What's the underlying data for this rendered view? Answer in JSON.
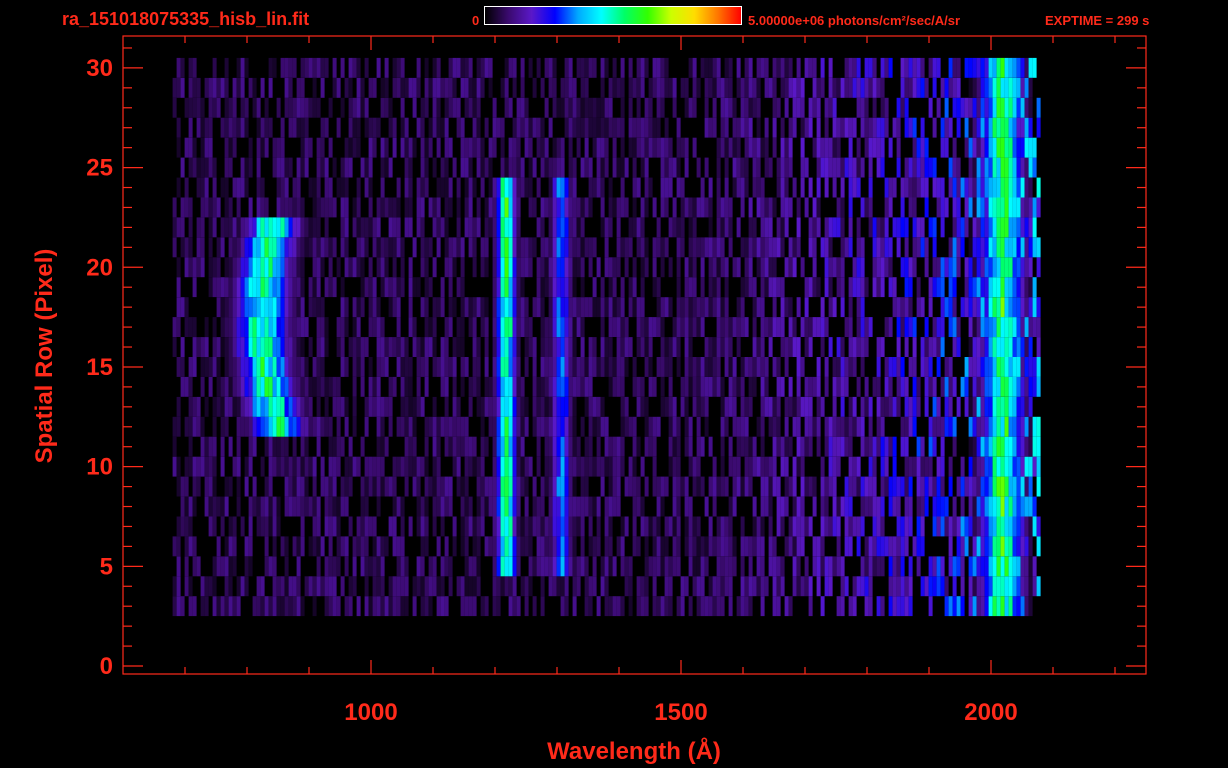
{
  "header": {
    "filename": "ra_151018075335_hisb_lin.fit",
    "colorbar_min": "0",
    "colorbar_max": "5.00000e+06 photons/cm²/sec/A/sr",
    "exptime": "EXPTIME = 299 s"
  },
  "colors": {
    "axis": "#ff2a1a",
    "background": "#000000",
    "colormap": [
      "#000000",
      "#3a0a6e",
      "#5a18c8",
      "#0000ff",
      "#00aaff",
      "#00ffff",
      "#00ff66",
      "#33ff00",
      "#ccff00",
      "#ffdd00",
      "#ff7700",
      "#ff0000"
    ]
  },
  "chart_data": {
    "type": "heatmap",
    "title": "",
    "xlabel": "Wavelength (Å)",
    "ylabel": "Spatial Row (Pixel)",
    "xlim": [
      600,
      2250
    ],
    "ylim": [
      -0.4,
      31.6
    ],
    "xticks": [
      1000,
      1500,
      2000
    ],
    "yticks": [
      0,
      5,
      10,
      15,
      20,
      25,
      30
    ],
    "grid": false,
    "colorscale": {
      "min": 0,
      "max": 5000000,
      "unit": "photons/cm²/sec/A/sr"
    },
    "data_extent": {
      "x": [
        680,
        2080
      ],
      "rows": [
        3,
        30
      ]
    },
    "features": [
      {
        "label": "arc emission",
        "x_center": 860,
        "rows": [
          12,
          22
        ],
        "level": 0.5
      },
      {
        "label": "line emission",
        "x_center": 1215,
        "rows": [
          5,
          24
        ],
        "level": 0.55
      },
      {
        "label": "line emission",
        "x_center": 1304,
        "rows": [
          5,
          24
        ],
        "level": 0.32
      },
      {
        "label": "edge emission",
        "x_center": 2015,
        "rows": [
          3,
          30
        ],
        "level": 0.55
      }
    ]
  }
}
